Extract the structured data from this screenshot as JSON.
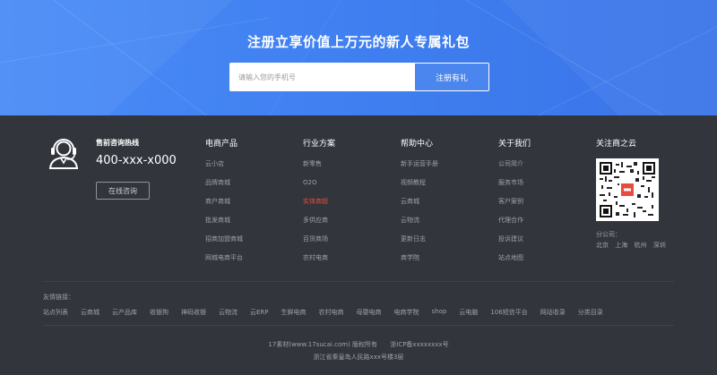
{
  "banner": {
    "title": "注册立享价值上万元的新人专属礼包",
    "phone_placeholder": "请输入您的手机号",
    "register_button": "注册有礼",
    "background_color": "#4a8cf7"
  },
  "hotline": {
    "icon": "customer-service-headset-icon",
    "title": "售前咨询热线",
    "phone": "400-xxx-x000",
    "consult_button": "在线咨询"
  },
  "columns": [
    {
      "title": "电商产品",
      "items": [
        "云小店",
        "品牌商城",
        "商户商城",
        "批发商城",
        "招商加盟商城",
        "网城电商平台"
      ]
    },
    {
      "title": "行业方案",
      "items": [
        "新零售",
        "O2O",
        "实体商超",
        "多供应商",
        "百货商场",
        "农村电商"
      ],
      "highlight_index": 2,
      "highlight_color": "#e74c3c"
    },
    {
      "title": "帮助中心",
      "items": [
        "新手运营手册",
        "视频教程",
        "云商城",
        "云物流",
        "更新日志",
        "商学院"
      ]
    },
    {
      "title": "关于我们",
      "items": [
        "公司简介",
        "服务市场",
        "客户案例",
        "代理合作",
        "投诉建议",
        "站点地图"
      ]
    }
  ],
  "follow": {
    "title": "关注商之云",
    "qr_icon": "qr-code-icon",
    "branch_label": "分公司：",
    "cities": [
      "北京",
      "上海",
      "杭州",
      "深圳"
    ]
  },
  "friends": {
    "label": "友情链接：",
    "links": [
      "站点列表",
      "云商城",
      "云产品库",
      "收银狗",
      "神码收银",
      "云物流",
      "云ERP",
      "生鲜电商",
      "农村电商",
      "母婴电商",
      "电商学院",
      "shop",
      "云电脑",
      "106短信平台",
      "网站收录",
      "分类目录"
    ]
  },
  "copyright": {
    "text": "17素材(www.17sucai.com) 版权所有",
    "icp": "浙ICP备xxxxxxxx号",
    "address": "浙江省秦皇岛人民路xxx号楼3层"
  }
}
